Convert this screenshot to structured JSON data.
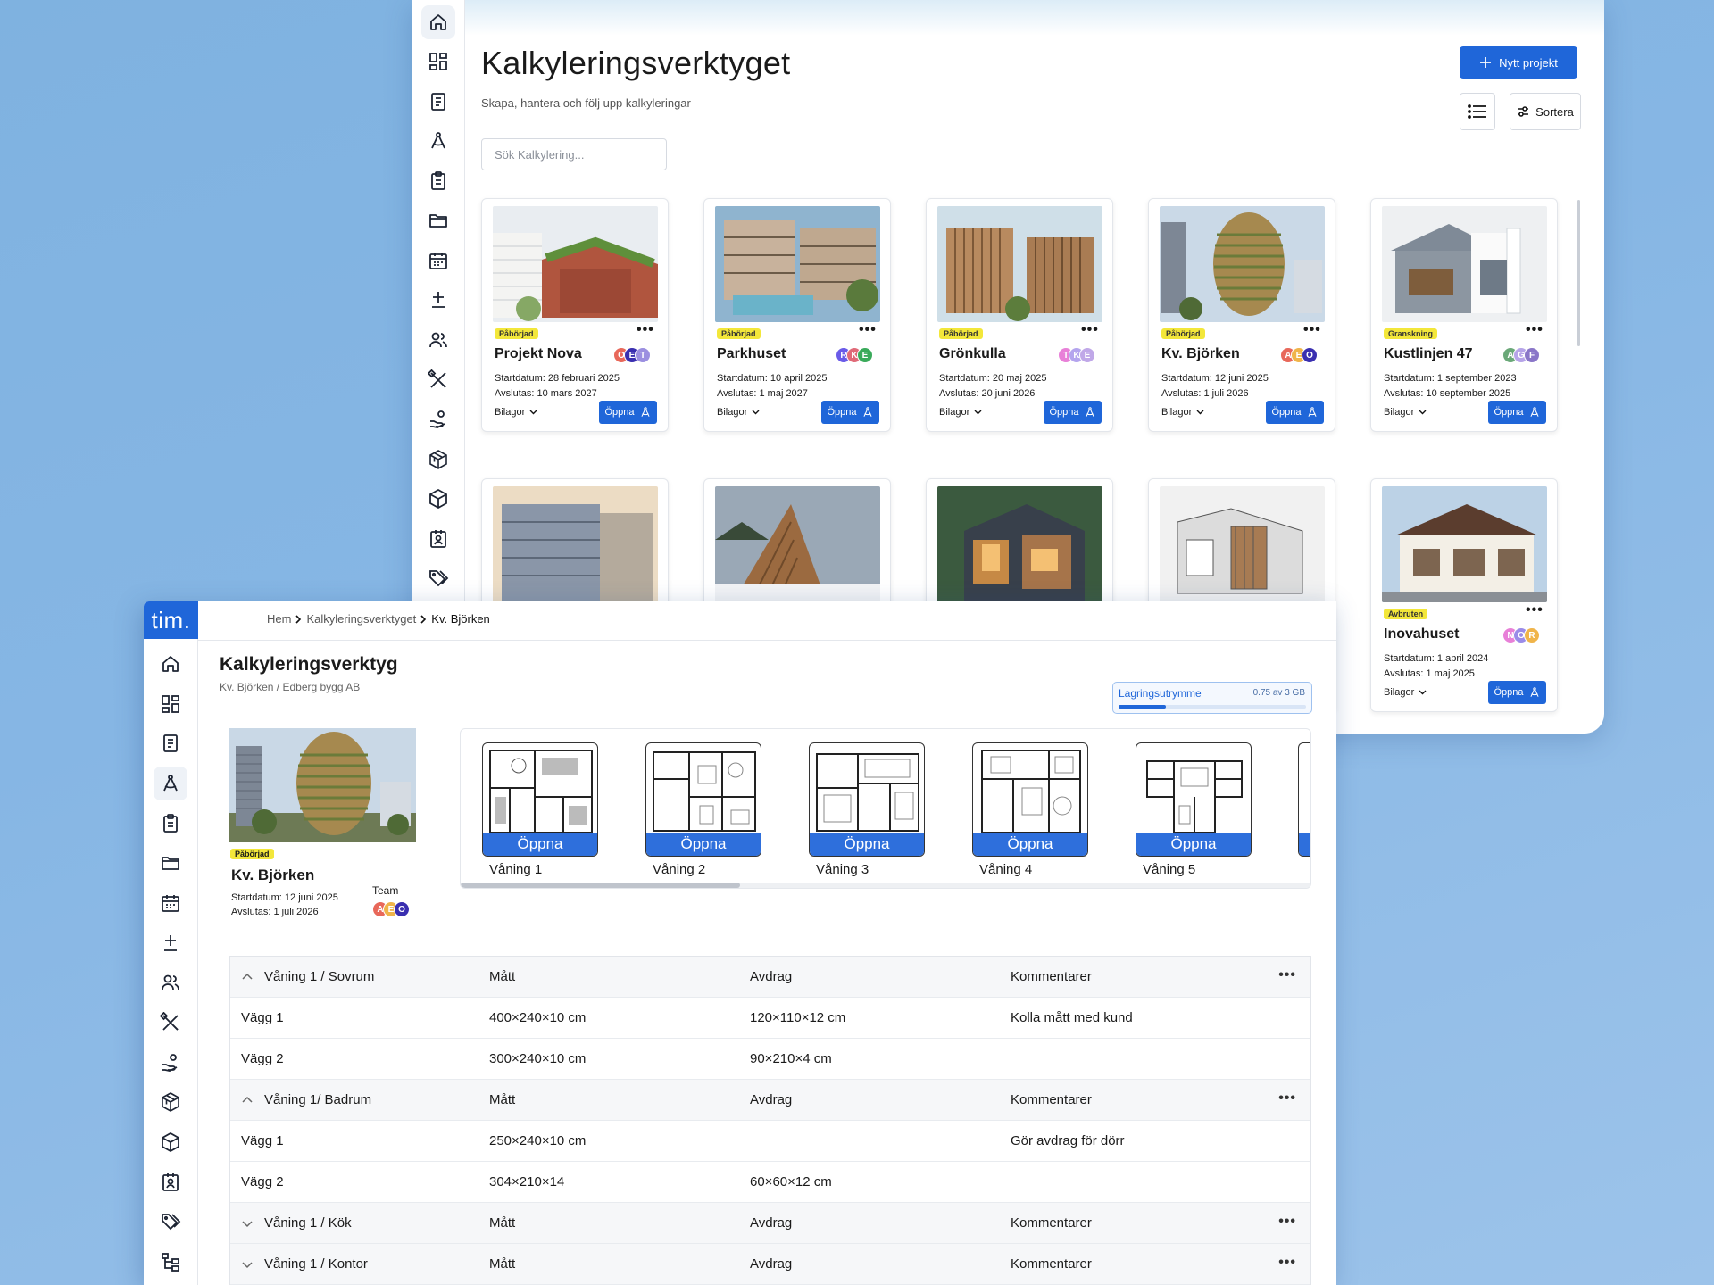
{
  "back": {
    "title": "Kalkyleringsverktyget",
    "subtitle": "Skapa, hantera och  följ upp kalkyleringar",
    "search_placeholder": "Sök Kalkylering...",
    "new_project": "Nytt projekt",
    "sort": "Sortera",
    "open_label": "Öppna",
    "attachments_label": "Bilagor",
    "more_label": "•••",
    "cards": [
      {
        "status": "Påbörjad",
        "name": "Projekt Nova",
        "start": "Startdatum: 28 februari 2025",
        "end": "Avslutas: 10 mars 2027",
        "team": [
          "O",
          "E",
          "T"
        ],
        "colors": [
          "#e8685a",
          "#3a2fb0",
          "#9b8fe0"
        ]
      },
      {
        "status": "Påbörjad",
        "name": "Parkhuset",
        "start": "Startdatum: 10 april 2025",
        "end": "Avslutas: 1 maj 2027",
        "team": [
          "R",
          "K",
          "E"
        ],
        "colors": [
          "#6a5be8",
          "#e06a78",
          "#3aaa5a"
        ]
      },
      {
        "status": "Påbörjad",
        "name": "Grönkulla",
        "start": "Startdatum: 20 maj 2025",
        "end": "Avslutas: 20 juni 2026",
        "team": [
          "T",
          "K",
          "E"
        ],
        "colors": [
          "#e880d8",
          "#b4a4ee",
          "#c0a8e8"
        ]
      },
      {
        "status": "Påbörjad",
        "name": "Kv. Björken",
        "start": "Startdatum: 12 juni 2025",
        "end": "Avslutas: 1 juli 2026",
        "team": [
          "A",
          "E",
          "O"
        ],
        "colors": [
          "#e8685a",
          "#f0b44a",
          "#3a2fb0"
        ]
      },
      {
        "status": "Granskning",
        "name": "Kustlinjen 47",
        "start": "Startdatum: 1 september 2023",
        "end": "Avslutas: 10 september 2025",
        "team": [
          "A",
          "G",
          "F"
        ],
        "colors": [
          "#6aa878",
          "#b6a4e8",
          "#8a76c8"
        ]
      },
      {
        "status": "Avbruten",
        "name": "Inovahuset",
        "start": "Startdatum: 1 april 2024",
        "end": "Avslutas: 1 maj 2025",
        "team": [
          "N",
          "O",
          "R"
        ],
        "colors": [
          "#e880d8",
          "#9a8be8",
          "#f0b44a"
        ]
      }
    ]
  },
  "front": {
    "logo": "tim.",
    "breadcrumb": [
      "Hem",
      "Kalkyleringsverktyget",
      "Kv. Björken"
    ],
    "title": "Kalkyleringsverktyg",
    "subtitle": "Kv. Björken  /  Edberg bygg AB",
    "storage": {
      "label": "Lagringsutrymme",
      "value": "0.75 av 3 GB",
      "fraction": 0.25
    },
    "project": {
      "status": "Påbörjad",
      "name": "Kv. Björken",
      "start": "Startdatum: 12 juni 2025",
      "end": "Avslutas: 1 juli 2026",
      "team_label": "Team",
      "team": [
        "A",
        "E",
        "O"
      ],
      "colors": [
        "#e8685a",
        "#f0b44a",
        "#3a2fb0"
      ]
    },
    "floors": [
      {
        "label": "Våning 1",
        "open": "Öppna"
      },
      {
        "label": "Våning 2",
        "open": "Öppna"
      },
      {
        "label": "Våning 3",
        "open": "Öppna"
      },
      {
        "label": "Våning 4",
        "open": "Öppna"
      },
      {
        "label": "Våning 5",
        "open": "Öppna"
      }
    ],
    "table": {
      "col_matt": "Mått",
      "col_avdrag": "Avdrag",
      "col_komm": "Kommentarer",
      "groups": [
        {
          "title": "Våning 1 / Sovrum",
          "expanded": true,
          "rows": [
            {
              "name": "Vägg 1",
              "matt": "400×240×10 cm",
              "avdrag": "120×110×12 cm",
              "komm": "Kolla mått med kund"
            },
            {
              "name": "Vägg 2",
              "matt": "300×240×10 cm",
              "avdrag": "90×210×4 cm",
              "komm": ""
            }
          ]
        },
        {
          "title": "Våning 1/ Badrum",
          "expanded": true,
          "rows": [
            {
              "name": "Vägg 1",
              "matt": "250×240×10 cm",
              "avdrag": "",
              "komm": "Gör avdrag för dörr"
            },
            {
              "name": "Vägg 2",
              "matt": "304×210×14",
              "avdrag": "60×60×12 cm",
              "komm": ""
            }
          ]
        },
        {
          "title": "Våning 1 / Kök",
          "expanded": false,
          "rows": []
        },
        {
          "title": "Våning 1 / Kontor",
          "expanded": false,
          "rows": []
        }
      ]
    }
  },
  "sidebar_icons": [
    "home-icon",
    "dashboard-icon",
    "document-icon",
    "compass-icon",
    "clipboard-icon",
    "folder-icon",
    "calendar-icon",
    "plus-minus-icon",
    "users-icon",
    "tools-icon",
    "hand-coins-icon",
    "boxes-icon",
    "box-icon",
    "badge-icon",
    "tags-icon",
    "hierarchy-icon"
  ]
}
